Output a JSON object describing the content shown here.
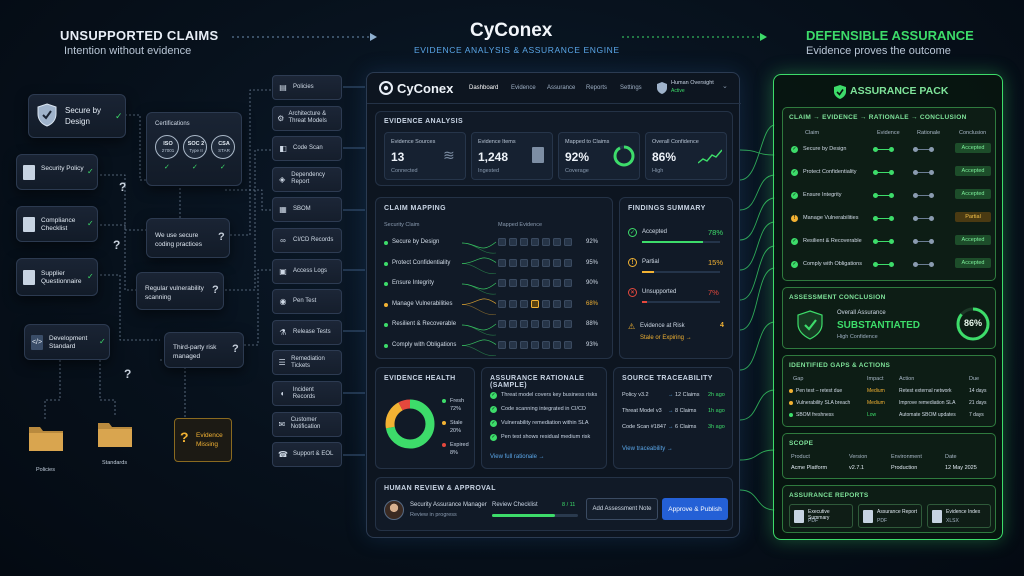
{
  "left": {
    "title": "UNSUPPORTED CLAIMS",
    "subtitle": "Intention without evidence",
    "secure_by_design": "Secure by Design",
    "certifications": {
      "title": "Certifications",
      "badges": [
        {
          "l1": "ISO",
          "l2": "27001"
        },
        {
          "l1": "SOC 2",
          "l2": "Type II"
        },
        {
          "l1": "CSA",
          "l2": "STAR"
        }
      ]
    },
    "docs": [
      "Security Policy",
      "Compliance Checklist",
      "Supplier Questionnaire",
      "Development Standard"
    ],
    "claims": [
      "We use secure coding practices",
      "Regular vulnerability scanning",
      "Third-party risk managed"
    ],
    "folders": [
      "Policies",
      "Standards"
    ],
    "evidence_missing": "Evidence Missing",
    "question_mark": "?"
  },
  "center_header": {
    "title": "CyConex",
    "subtitle": "EVIDENCE ANALYSIS & ASSURANCE ENGINE"
  },
  "right_header": {
    "title": "DEFENSIBLE ASSURANCE",
    "subtitle": "Evidence proves the outcome"
  },
  "sources": [
    {
      "label": "Policies",
      "icon": "▤"
    },
    {
      "label": "Architecture & Threat Models",
      "icon": "⚙"
    },
    {
      "label": "Code Scan",
      "icon": "◧"
    },
    {
      "label": "Dependency Report",
      "icon": "◈"
    },
    {
      "label": "SBOM",
      "icon": "▦"
    },
    {
      "label": "CI/CD Records",
      "icon": "∞"
    },
    {
      "label": "Access Logs",
      "icon": "▣"
    },
    {
      "label": "Pen Test",
      "icon": "◉"
    },
    {
      "label": "Release Tests",
      "icon": "⚗"
    },
    {
      "label": "Remediation Tickets",
      "icon": "☰"
    },
    {
      "label": "Incident Records",
      "icon": "◐"
    },
    {
      "label": "Customer Notification",
      "icon": "✉"
    },
    {
      "label": "Support & EOL",
      "icon": "☎"
    }
  ],
  "app": {
    "brand": "CyConex",
    "tabs": [
      "Dashboard",
      "Evidence",
      "Assurance",
      "Reports",
      "Settings"
    ],
    "oversight_label": "Human Oversight",
    "oversight_status": "Active",
    "evidence_analysis": {
      "title": "EVIDENCE ANALYSIS",
      "stats": [
        {
          "label": "Evidence Sources",
          "value": "13",
          "sub": "Connected"
        },
        {
          "label": "Evidence Items",
          "value": "1,248",
          "sub": "Ingested"
        },
        {
          "label": "Mapped to Claims",
          "value": "92%",
          "sub": "Coverage"
        },
        {
          "label": "Overall Confidence",
          "value": "86%",
          "sub": "High"
        }
      ]
    },
    "claim_mapping": {
      "title": "CLAIM MAPPING",
      "col_claim": "Security Claim",
      "col_evidence": "Mapped Evidence",
      "rows": [
        {
          "claim": "Secure by Design",
          "pct": "92%",
          "status": "green"
        },
        {
          "claim": "Protect Confidentiality",
          "pct": "95%",
          "status": "green"
        },
        {
          "claim": "Ensure Integrity",
          "pct": "90%",
          "status": "green"
        },
        {
          "claim": "Manage Vulnerabilities",
          "pct": "68%",
          "status": "amber"
        },
        {
          "claim": "Resilient & Recoverable",
          "pct": "88%",
          "status": "green"
        },
        {
          "claim": "Comply with Obligations",
          "pct": "93%",
          "status": "green"
        }
      ]
    },
    "findings": {
      "title": "FINDINGS SUMMARY",
      "items": [
        {
          "label": "Accepted",
          "value": "78%",
          "fill": 0.78,
          "color": "#3ddc6a"
        },
        {
          "label": "Partial",
          "value": "15%",
          "fill": 0.15,
          "color": "#f2b233"
        },
        {
          "label": "Unsupported",
          "value": "7%",
          "fill": 0.07,
          "color": "#e5483d"
        }
      ],
      "at_risk_label": "Evidence at Risk",
      "at_risk_value": "4",
      "at_risk_link": "Stale or Expiring →"
    },
    "health": {
      "title": "EVIDENCE HEALTH",
      "items": [
        {
          "label": "Fresh",
          "value": "72%",
          "fraction": 0.72,
          "color": "#3ddc6a"
        },
        {
          "label": "Stale",
          "value": "20%",
          "fraction": 0.2,
          "color": "#f2b233"
        },
        {
          "label": "Expired",
          "value": "8%",
          "fraction": 0.08,
          "color": "#e5483d"
        }
      ]
    },
    "rationale": {
      "title": "ASSURANCE RATIONALE (SAMPLE)",
      "items": [
        "Threat model covers key business risks",
        "Code scanning integrated in CI/CD",
        "Vulnerability remediation within SLA",
        "Pen test shows residual medium risk"
      ],
      "link": "View full rationale →"
    },
    "traceability": {
      "title": "SOURCE TRACEABILITY",
      "rows": [
        {
          "src": "Policy v3.2",
          "claims": "12 Claims",
          "ago": "2h ago"
        },
        {
          "src": "Threat Model v3",
          "claims": "8 Claims",
          "ago": "1h ago"
        },
        {
          "src": "Code Scan #1847",
          "claims": "6 Claims",
          "ago": "3h ago"
        }
      ],
      "link": "View traceability →"
    },
    "review": {
      "title": "HUMAN REVIEW & APPROVAL",
      "person": "Security Assurance Manager",
      "status": "Review in progress",
      "checklist_label": "Review Checklist",
      "checklist_value": "8 / 11",
      "checklist_fraction": 0.727,
      "note_button": "Add Assessment Note",
      "publish_button": "Approve & Publish"
    }
  },
  "pack": {
    "title": "ASSURANCE PACK",
    "chain": "CLAIM → EVIDENCE → RATIONALE → CONCLUSION",
    "cols": [
      "Claim",
      "Evidence",
      "Rationale",
      "Conclusion"
    ],
    "rows": [
      {
        "claim": "Secure by Design",
        "result": "Accepted",
        "kind": "acc"
      },
      {
        "claim": "Protect Confidentiality",
        "result": "Accepted",
        "kind": "acc"
      },
      {
        "claim": "Ensure Integrity",
        "result": "Accepted",
        "kind": "acc"
      },
      {
        "claim": "Manage Vulnerabilities",
        "result": "Partial",
        "kind": "par"
      },
      {
        "claim": "Resilient & Recoverable",
        "result": "Accepted",
        "kind": "acc"
      },
      {
        "claim": "Comply with Obligations",
        "result": "Accepted",
        "kind": "acc"
      }
    ],
    "conclusion": {
      "title": "ASSESSMENT CONCLUSION",
      "label": "Overall Assurance",
      "value": "SUBSTANTIATED",
      "confidence": "High Confidence",
      "pct": "86%",
      "fraction": 0.86
    },
    "gaps": {
      "title": "IDENTIFIED GAPS & ACTIONS",
      "cols": [
        "Gap",
        "Impact",
        "Action",
        "Due"
      ],
      "rows": [
        {
          "gap": "Pen test – retest due",
          "impact": "Medium",
          "impact_color": "#f2b233",
          "action": "Retest external network",
          "due": "14 days"
        },
        {
          "gap": "Vulnerability SLA breach",
          "impact": "Medium",
          "impact_color": "#f2b233",
          "action": "Improve remediation SLA",
          "due": "21 days"
        },
        {
          "gap": "SBOM freshness",
          "impact": "Low",
          "impact_color": "#3ddc6a",
          "action": "Automate SBOM updates",
          "due": "7 days"
        }
      ]
    },
    "scope": {
      "title": "SCOPE",
      "fields": [
        {
          "label": "Product",
          "value": "Acme Platform"
        },
        {
          "label": "Version",
          "value": "v2.7.1"
        },
        {
          "label": "Environment",
          "value": "Production"
        },
        {
          "label": "Date",
          "value": "12 May 2025"
        }
      ]
    },
    "reports": {
      "title": "ASSURANCE REPORTS",
      "items": [
        {
          "name": "Executive Summary",
          "fmt": "PDF"
        },
        {
          "name": "Assurance Report",
          "fmt": "PDF"
        },
        {
          "name": "Evidence Index",
          "fmt": "XLSX"
        }
      ]
    }
  },
  "colors": {
    "accent_green": "#3ddc6a",
    "accent_amber": "#f2b233",
    "accent_red": "#e5483d",
    "accent_blue": "#2f6fe0"
  }
}
